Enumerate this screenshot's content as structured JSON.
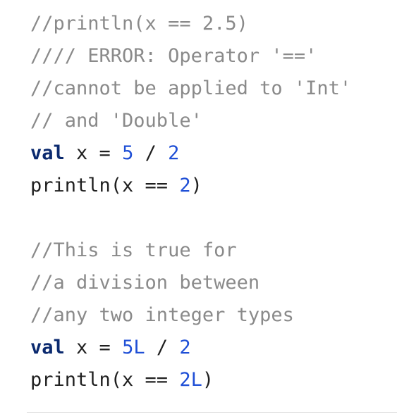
{
  "code": {
    "lines": [
      {
        "kind": "comment",
        "text": "//println(x == 2.5)"
      },
      {
        "kind": "comment",
        "text": "//// ERROR: Operator '=='"
      },
      {
        "kind": "comment",
        "text": "//cannot be applied to 'Int'"
      },
      {
        "kind": "comment",
        "text": "// and 'Double'"
      },
      {
        "kind": "code",
        "keyword": "val",
        "rest": " x = ",
        "num1": "5",
        "op": " / ",
        "num2": "2"
      },
      {
        "kind": "code",
        "plain1": "println(x == ",
        "num": "2",
        "plain2": ")"
      },
      {
        "kind": "blank",
        "text": ""
      },
      {
        "kind": "comment",
        "text": "//This is true for"
      },
      {
        "kind": "comment",
        "text": "//a division between"
      },
      {
        "kind": "comment",
        "text": "//any two integer types"
      },
      {
        "kind": "code",
        "keyword": "val",
        "rest": " x = ",
        "num1": "5L",
        "op": " / ",
        "num2": "2"
      },
      {
        "kind": "code",
        "plain1": "println(x == ",
        "num": "2L",
        "plain2": ")"
      }
    ]
  },
  "colors": {
    "comment": "#8a8a8a",
    "keyword": "#0b2a6f",
    "number": "#1f4fd6",
    "text": "#1f1f1f"
  }
}
